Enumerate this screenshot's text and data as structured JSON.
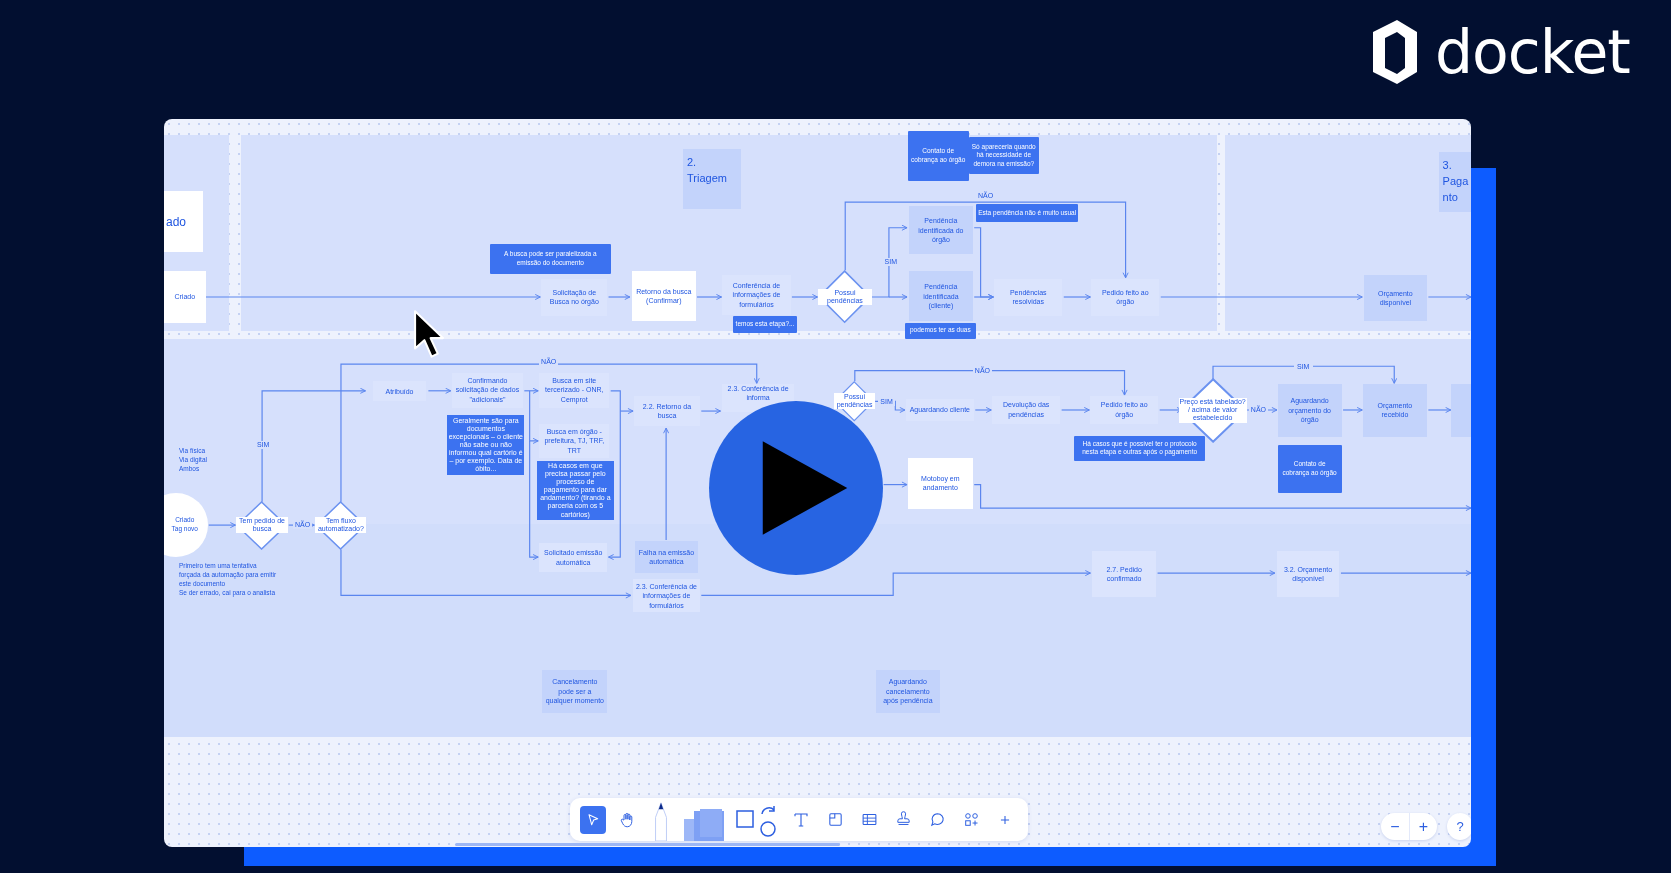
{
  "brand": {
    "name": "docket"
  },
  "board": {
    "nodes": [
      {
        "kind": "stub",
        "text": "ado"
      },
      {
        "kind": "stage",
        "text": "2.\nTriagem"
      },
      {
        "kind": "note",
        "text": "Contato de cobrança ao órgão"
      },
      {
        "kind": "note",
        "text": "Só apareceria quando há necessidade de demora na emissão?"
      },
      {
        "kind": "label",
        "text": "NÃO"
      },
      {
        "kind": "shade",
        "text": "Pendência identificada do órgão"
      },
      {
        "kind": "note",
        "text": "Esta pendência não é muito usual"
      },
      {
        "kind": "stage",
        "text": "3.\nPaga\nnto"
      },
      {
        "kind": "note",
        "text": "A busca pode ser paralelizada a emissão do documento"
      },
      {
        "kind": "label",
        "text": "SIM"
      },
      {
        "kind": "white",
        "text": "Criado"
      },
      {
        "kind": "box",
        "text": "Solicitação de Busca no órgão"
      },
      {
        "kind": "white",
        "text": "Retorno da busca (Confirmar)"
      },
      {
        "kind": "box",
        "text": "Conferência de informações de formulários"
      },
      {
        "kind": "diamond",
        "text": "Possui pendências"
      },
      {
        "kind": "shade",
        "text": "Pendência identificada (cliente)"
      },
      {
        "kind": "box",
        "text": "Pendências resolvidas"
      },
      {
        "kind": "box",
        "text": "Pedido feito ao órgão"
      },
      {
        "kind": "shade",
        "text": "Orçamento disponível"
      },
      {
        "kind": "note",
        "text": "temos esta etapa?..."
      },
      {
        "kind": "note",
        "text": "podemos ter as duas"
      },
      {
        "kind": "label",
        "text": "NÃO"
      },
      {
        "kind": "label",
        "text": "NÃO"
      },
      {
        "kind": "label",
        "text": "SIM"
      },
      {
        "kind": "box",
        "text": "Atribuído"
      },
      {
        "kind": "box",
        "text": "Confirmando solicitação de dados \"adicionais\""
      },
      {
        "kind": "box",
        "text": "Busca em site tercerizado - ONR, Cemprot"
      },
      {
        "kind": "box",
        "text": "2.2. Retorno da busca"
      },
      {
        "kind": "partial",
        "text": "2.3. Conferência de\ninforma"
      },
      {
        "kind": "diamond",
        "text": "Possui pendências"
      },
      {
        "kind": "label",
        "text": "SIM"
      },
      {
        "kind": "box",
        "text": "Aguardando cliente"
      },
      {
        "kind": "box",
        "text": "Devolução das pendências"
      },
      {
        "kind": "box",
        "text": "Pedido feito ao órgão"
      },
      {
        "kind": "diamond",
        "text": "Preço está tabelado? / acima de valor estabelecido"
      },
      {
        "kind": "label",
        "text": "NÃO"
      },
      {
        "kind": "shade",
        "text": "Aguardando orçamento do órgão"
      },
      {
        "kind": "shade",
        "text": "Orçamento recebido"
      },
      {
        "kind": "shade"
      },
      {
        "kind": "text",
        "text": "Via física\nVia digital\nAmbos"
      },
      {
        "kind": "label",
        "text": "SIM"
      },
      {
        "kind": "tiny",
        "text": "Geralmente são para documentos excepcionais – o cliente não sabe ou não informou qual cartório é – por exemplo. Data de óbito..."
      },
      {
        "kind": "box",
        "text": "Busca em órgão - prefeitura, TJ, TRF, TRT"
      },
      {
        "kind": "tiny",
        "text": "Há casos em que precisa passar pelo processo de pagamento para dar andamento? (tirando a parceria com os 5 cartórios)"
      },
      {
        "kind": "white",
        "text": "Motoboy em andamento"
      },
      {
        "kind": "note",
        "text": "Há casos que é possível ter o protocolo nesta etapa e outras após o pagamento"
      },
      {
        "kind": "note",
        "text": "Contato de cobrança ao órgão"
      },
      {
        "kind": "circle",
        "text": "Criado\nTag novo"
      },
      {
        "kind": "diamond",
        "text": "Tem pedido de busca"
      },
      {
        "kind": "label",
        "text": "NÃO"
      },
      {
        "kind": "diamond",
        "text": "Tem fluxo automatizado?"
      },
      {
        "kind": "box",
        "text": "Solicitado emissão automática"
      },
      {
        "kind": "shade",
        "text": "Falha na emissão automática"
      },
      {
        "kind": "box",
        "text": "2.7. Pedido confirmado"
      },
      {
        "kind": "box",
        "text": "3.2. Orçamento disponível"
      },
      {
        "kind": "text",
        "text": "Primeiro tem uma tentativa forçada da automação para emitir este documento\nSe der errado, cai para o analista"
      },
      {
        "kind": "box",
        "text": "2.3. Conferência de informações de formulários"
      },
      {
        "kind": "shade",
        "text": "Cancelamento pode ser a qualquer momento"
      },
      {
        "kind": "shade",
        "text": "Aguardando cancelamento após pendência"
      }
    ]
  },
  "toolbar": {
    "tools": [
      {
        "kind": "select",
        "selected": true
      },
      {
        "kind": "hand",
        "selected": false
      },
      {
        "kind": "pen",
        "selected": false
      },
      {
        "kind": "notes",
        "selected": false
      },
      {
        "kind": "shapes",
        "selected": false
      },
      {
        "kind": "text",
        "selected": false
      },
      {
        "kind": "frame",
        "selected": false
      },
      {
        "kind": "table",
        "selected": false
      },
      {
        "kind": "stamp",
        "selected": false
      },
      {
        "kind": "comment",
        "selected": false
      },
      {
        "kind": "components",
        "selected": false
      },
      {
        "kind": "add",
        "selected": false
      }
    ]
  },
  "zoom_controls": {
    "out": "−",
    "in": "+",
    "help": "?"
  }
}
